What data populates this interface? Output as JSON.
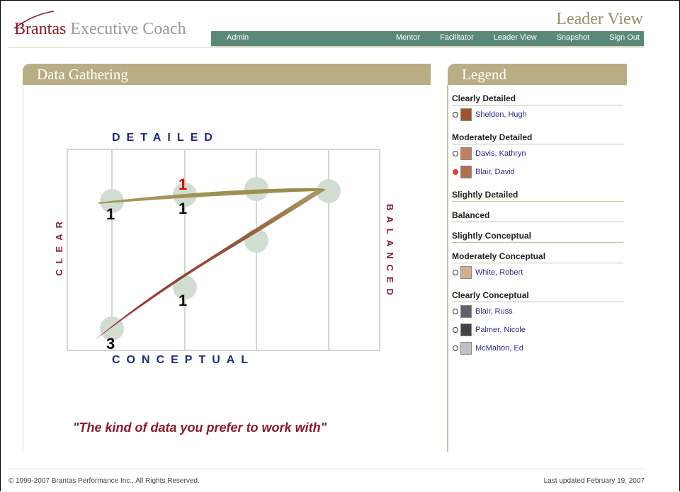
{
  "header": {
    "logo_bold": "Brantas",
    "logo_rest": " Executive Coach",
    "page_title": "Leader View"
  },
  "nav": {
    "admin": "Admin",
    "items": [
      "Mentor",
      "Facilitator",
      "Leader View",
      "Snapshot",
      "Sign Out"
    ]
  },
  "panel": {
    "title": "Data Gathering",
    "axis_top": "DETAILED",
    "axis_bottom": "CONCEPTUAL",
    "axis_left": "CLEAR",
    "axis_right": "BALANCED",
    "quote": "\"The kind of data you prefer to work with\"",
    "counts": [
      {
        "label": "1",
        "color": "#111"
      },
      {
        "label": "1",
        "color": "#e00000"
      },
      {
        "label": "1",
        "color": "#111"
      },
      {
        "label": "1",
        "color": "#111"
      },
      {
        "label": "3",
        "color": "#111"
      }
    ]
  },
  "legend": {
    "title": "Legend",
    "categories": [
      {
        "name": "Clearly Detailed",
        "people": [
          {
            "name": "Sheldon, Hugh",
            "selected": false
          }
        ]
      },
      {
        "name": "Moderately Detailed",
        "people": [
          {
            "name": "Davis, Kathryn",
            "selected": false
          },
          {
            "name": "Blair, David",
            "selected": true
          }
        ]
      },
      {
        "name": "Slightly Detailed",
        "people": []
      },
      {
        "name": "Balanced",
        "people": []
      },
      {
        "name": "Slightly Conceptual",
        "people": []
      },
      {
        "name": "Moderately Conceptual",
        "people": [
          {
            "name": "White, Robert",
            "selected": false
          }
        ]
      },
      {
        "name": "Clearly Conceptual",
        "people": [
          {
            "name": "Blair, Russ",
            "selected": false
          },
          {
            "name": "Palmer, Nicole",
            "selected": false
          },
          {
            "name": "McMahon, Ed",
            "selected": false
          }
        ]
      }
    ]
  },
  "footer": {
    "copyright": "© 1999-2007 Brantas Performance Inc., All Rights Reserved.",
    "updated": "Last updated February 19, 2007"
  },
  "colors": {
    "accent": "#b8ad84",
    "nav": "#5a8a77",
    "brand": "#8b1a2b",
    "axis_blue": "#1f2a7a"
  }
}
